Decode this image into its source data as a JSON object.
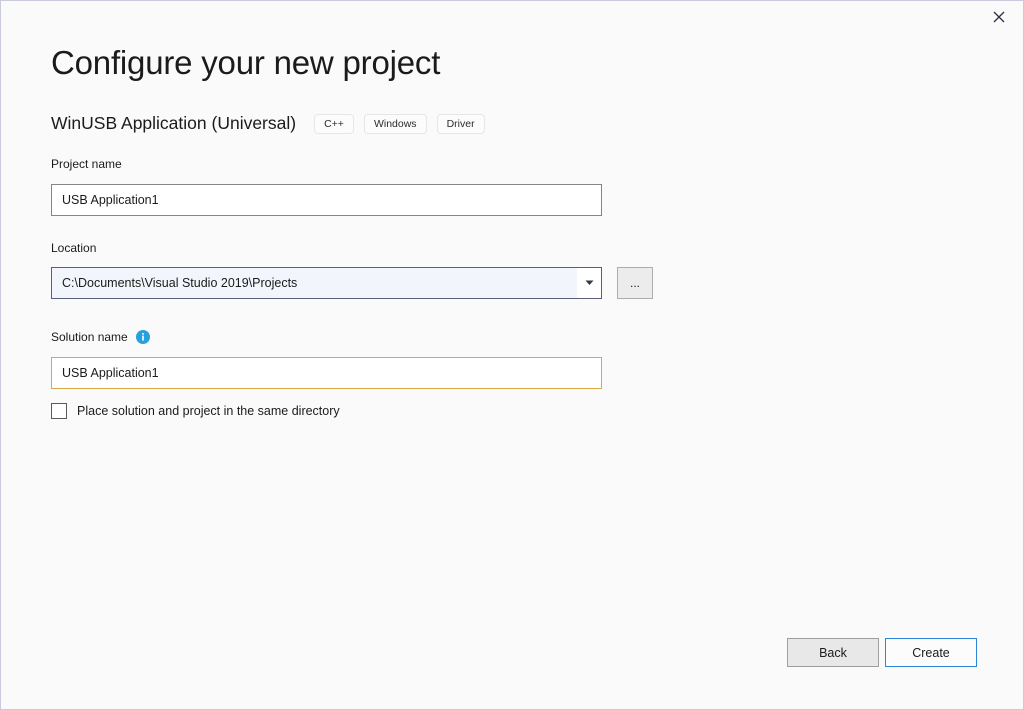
{
  "window": {
    "close_label": "×",
    "close_icon": "close-icon",
    "border_color": "#c8cadc",
    "background": "#fafafa"
  },
  "header": {
    "title": "Configure your new project",
    "template_name": "WinUSB Application (Universal)",
    "chips": [
      {
        "label": "C++"
      },
      {
        "label": "Windows"
      },
      {
        "label": "Driver"
      }
    ]
  },
  "form": {
    "project_name": {
      "label": "Project name",
      "value": "USB Application1",
      "placeholder": ""
    },
    "location": {
      "label": "Location",
      "value": "C:\\Documents\\Visual Studio 2019\\Projects",
      "dropdown_icon": "chevron-down-icon",
      "browse_label": "...",
      "browse_icon": "ellipsis-icon"
    },
    "solution_name": {
      "label": "Solution name",
      "value": "USB Application1",
      "placeholder": "",
      "info_icon": "info-icon",
      "focused": true,
      "focus_color": "#d8a945"
    },
    "same_directory_checkbox": {
      "label": "Place solution and project in the same directory",
      "checked": false
    }
  },
  "footer": {
    "back_label": "Back",
    "create_label": "Create",
    "accent_color": "#2b86d6"
  }
}
